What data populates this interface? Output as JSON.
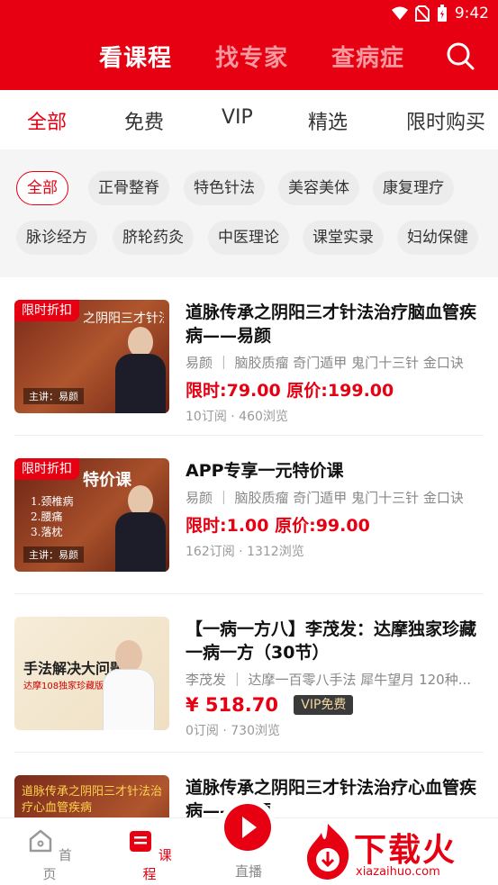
{
  "status_bar": {
    "time": "9:42"
  },
  "header": {
    "tabs": [
      {
        "label": "看课程",
        "active": true
      },
      {
        "label": "找专家",
        "active": false
      },
      {
        "label": "查病症",
        "active": false
      }
    ],
    "search_icon": "search-icon"
  },
  "subtabs": [
    {
      "label": "全部",
      "active": true
    },
    {
      "label": "免费"
    },
    {
      "label": "VIP"
    },
    {
      "label": "精选"
    },
    {
      "label": "限时购买"
    }
  ],
  "chips": [
    {
      "label": "全部",
      "active": true
    },
    {
      "label": "正骨整脊"
    },
    {
      "label": "特色针法"
    },
    {
      "label": "美容美体"
    },
    {
      "label": "康复理疗"
    },
    {
      "label": "脉诊经方"
    },
    {
      "label": "脐轮药灸"
    },
    {
      "label": "中医理论"
    },
    {
      "label": "课堂实录"
    },
    {
      "label": "妇幼保健"
    }
  ],
  "courses": [
    {
      "badge": "限时折扣",
      "thumb_title": "之阴阳三才针法治疗脑血管疾病",
      "thumb_speaker": "主讲：易颜",
      "title": "道脉传承之阴阳三才针法治疗脑血管疾病——易颜",
      "tags": "易颜 ｜ 脑胶质瘤 奇门遁甲 鬼门十三针 金口诀",
      "price": "限时:79.00 原价:199.00",
      "stats": "10订阅 · 460浏览"
    },
    {
      "badge": "限时折扣",
      "thumb_title": "特价课",
      "thumb_speaker": "主讲：易颜",
      "title": "APP专享一元特价课",
      "tags": "易颜 ｜ 脑胶质瘤 奇门遁甲 鬼门十三针 金口诀",
      "price": "限时:1.00 原价:99.00",
      "stats": "162订阅 · 1312浏览"
    },
    {
      "badge": "",
      "thumb_title": "手法解决大问题",
      "thumb_speaker": "达摩108独家珍藏版",
      "title": "【一病一方八】李茂发：达摩独家珍藏一病一方（30节）",
      "tags": "李茂发 ｜ 达摩一百零八手法 犀牛望月 120种...",
      "price": "¥ 518.70",
      "vip_tag": "VIP免费",
      "stats": "0订阅 · 730浏览"
    },
    {
      "badge": "",
      "thumb_title": "道脉传承之阴阳三才针法治疗心血管疾病",
      "thumb_speaker": "",
      "title": "道脉传承之阴阳三才针法治疗心血管疾病——易颜",
      "tags": "",
      "price": "",
      "stats": ""
    }
  ],
  "bottom_nav": [
    {
      "label": "首页",
      "icon": "home-icon"
    },
    {
      "label": "课程",
      "icon": "course-icon",
      "active": true
    },
    {
      "label": "直播",
      "icon": "live-play-icon"
    }
  ],
  "watermark": {
    "text": "下载火",
    "sub": "xiazaihuo.com"
  },
  "colors": {
    "accent": "#e60012",
    "text": "#111111",
    "muted": "#888888",
    "bg": "#f5f5f5"
  }
}
